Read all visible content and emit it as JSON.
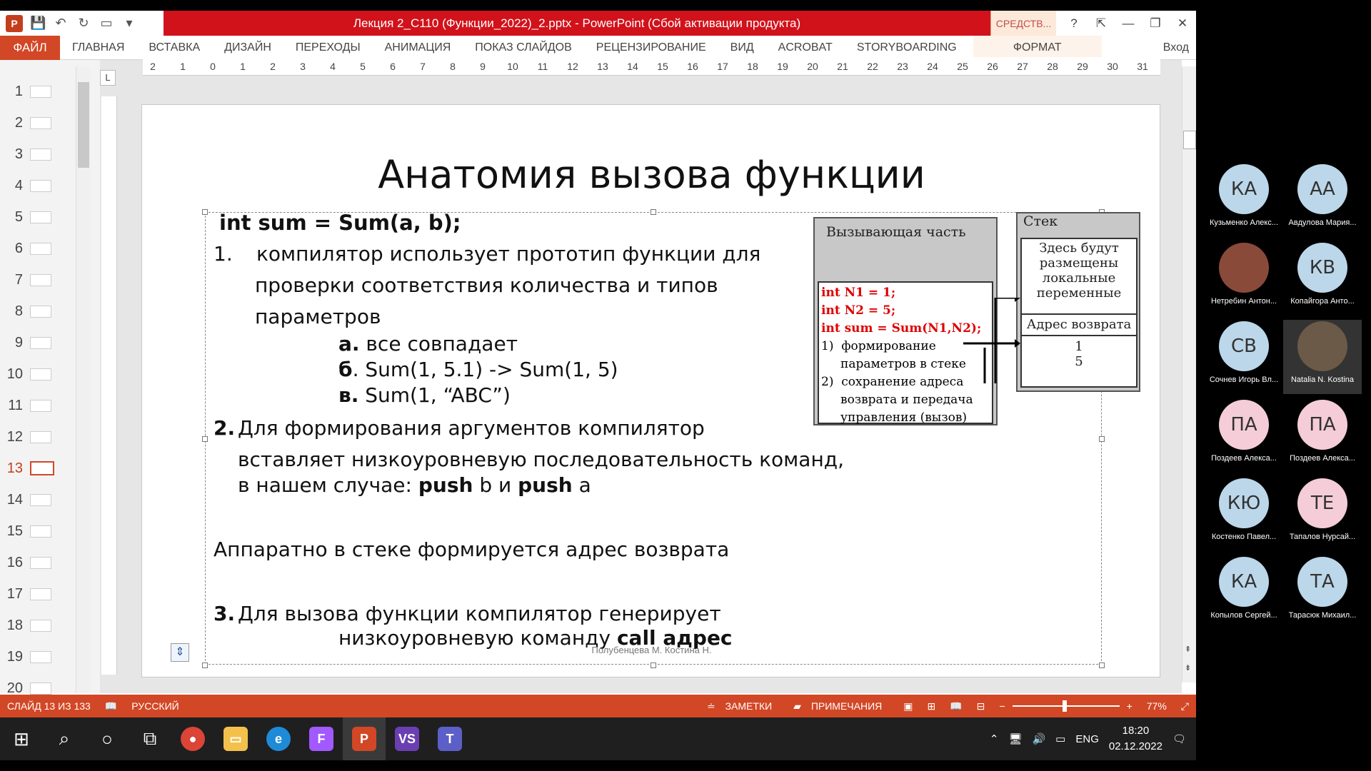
{
  "window": {
    "title": "Лекция 2_С110 (Функции_2022)_2.pptx - PowerPoint (Сбой активации продукта)",
    "context_tab": "СРЕДСТВ...",
    "help": "?",
    "minimize": "—",
    "restore": "❐",
    "close": "✕"
  },
  "ribbon": {
    "file": "ФАЙЛ",
    "tabs": [
      "ГЛАВНАЯ",
      "ВСТАВКА",
      "ДИЗАЙН",
      "ПЕРЕХОДЫ",
      "АНИМАЦИЯ",
      "ПОКАЗ СЛАЙДОВ",
      "РЕЦЕНЗИРОВАНИЕ",
      "ВИД",
      "ACROBAT",
      "STORYBOARDING"
    ],
    "format": "ФОРМАТ",
    "login": "Вход"
  },
  "thumbnails": [
    "1",
    "2",
    "3",
    "4",
    "5",
    "6",
    "7",
    "8",
    "9",
    "10",
    "11",
    "12",
    "13",
    "14",
    "15",
    "16",
    "17",
    "18",
    "19",
    "20"
  ],
  "active_slide": "13",
  "ruler": {
    "h_labels": [
      "2",
      "1",
      "0",
      "1",
      "2",
      "3",
      "4",
      "5",
      "6",
      "7",
      "8",
      "9",
      "10",
      "11",
      "12",
      "13",
      "14",
      "15",
      "16",
      "17",
      "18",
      "19",
      "20",
      "21",
      "22",
      "23",
      "24",
      "25",
      "26",
      "27",
      "28",
      "29",
      "30",
      "31"
    ],
    "corner": "L"
  },
  "slide": {
    "title": "Анатомия вызова функции",
    "line1": "int sum = Sum(a, b);",
    "item1_num": "1.",
    "item1_l1": "компилятор использует прототип функции для",
    "item1_l2": "проверки соответствия количества и типов",
    "item1_l3": "параметров",
    "a_lbl": "а.",
    "a_txt": " все совпадает",
    "b_lbl": "б",
    "b_txt": ". Sum(1, 5.1) ->  Sum(1, 5)",
    "c_lbl": "в.",
    "c_txt": " Sum(1, “ABC”)",
    "item2_num": "2.",
    "item2_l1": "Для формирования аргументов компилятор",
    "item2_l2": "вставляет низкоуровневую последовательность команд,",
    "item2_l3_pre": "в нашем случае: ",
    "push1": "push",
    "item2_l3_mid": " b и ",
    "push2": "push",
    "item2_l3_end": " a",
    "hw": "Аппаратно в стеке формируется адрес возврата",
    "item3_num": "3.",
    "item3_l1": "Для вызова функции компилятор генерирует",
    "item3_l2_pre": "низкоуровневую команду ",
    "item3_l2_bold": "call адрес",
    "footer": "Полубенцева М. Костина Н.",
    "diagram": {
      "caller_header": "Вызывающая часть",
      "code": [
        "int N1 = 1;",
        "int N2 = 5;",
        "int sum = Sum(N1,N2);"
      ],
      "steps": [
        "1)  формирование",
        "     параметров в стеке",
        "2)  сохранение адреса",
        "     возврата и передача",
        "     управления (вызов)"
      ],
      "stack_label": "Стек",
      "locals": [
        "Здесь будут",
        "размещены",
        "локальные",
        "переменные"
      ],
      "ret": "Адрес возврата",
      "vals": [
        "1",
        "5"
      ]
    }
  },
  "status": {
    "slide": "СЛАЙД 13 ИЗ 133",
    "lang": "РУССКИЙ",
    "notes": "ЗАМЕТКИ",
    "comments": "ПРИМЕЧАНИЯ",
    "zoom": "77%"
  },
  "taskbar": {
    "lang": "ENG",
    "time": "18:20",
    "date": "02.12.2022"
  },
  "participants": [
    {
      "initials": "КА",
      "name": "Кузьменко Алекс...",
      "color": "#bcd7ea"
    },
    {
      "initials": "АА",
      "name": "Авдулова Мария...",
      "color": "#bcd7ea"
    },
    {
      "initials": "",
      "name": "Нетребин Антон...",
      "color": "#8a4a3a"
    },
    {
      "initials": "КВ",
      "name": "Копайгора Анто...",
      "color": "#bcd7ea"
    },
    {
      "initials": "СВ",
      "name": "Сочнев Игорь Вл...",
      "color": "#bcd7ea"
    },
    {
      "initials": "",
      "name": "Natalia N. Kostina",
      "color": "#6b5a48"
    },
    {
      "initials": "ПА",
      "name": "Поздеев Алекса...",
      "color": "#f4cdd8"
    },
    {
      "initials": "ПА",
      "name": "Поздеев Алекса...",
      "color": "#f4cdd8"
    },
    {
      "initials": "КЮ",
      "name": "Костенко Павел...",
      "color": "#bcd7ea"
    },
    {
      "initials": "ТЕ",
      "name": "Тапалов Нурсай...",
      "color": "#f4cdd8"
    },
    {
      "initials": "КА",
      "name": "Копылов Сергей...",
      "color": "#bcd7ea"
    },
    {
      "initials": "ТА",
      "name": "Тарасюк Михаил...",
      "color": "#bcd7ea"
    }
  ]
}
